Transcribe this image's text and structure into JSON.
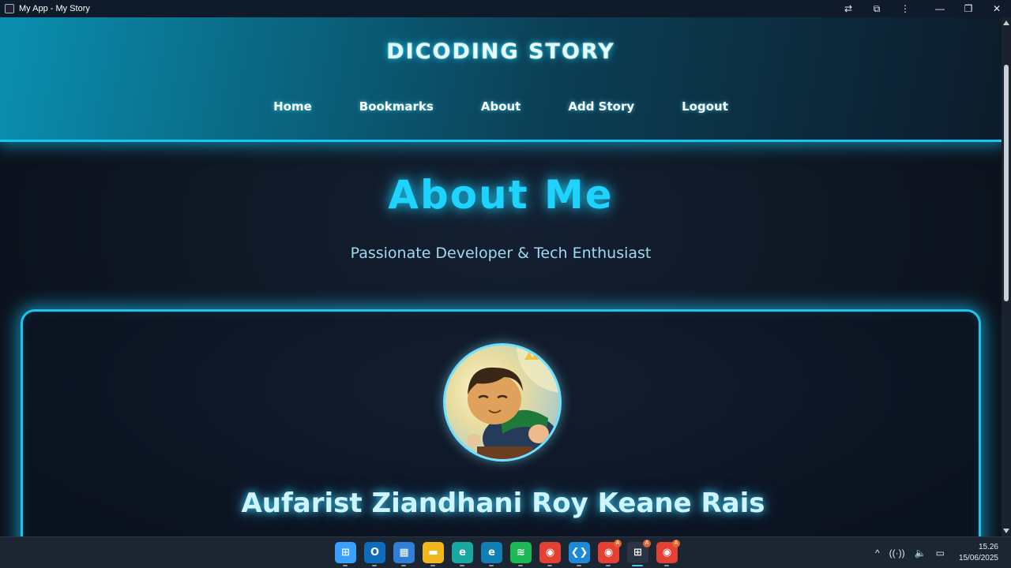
{
  "window": {
    "title": "My App - My Story",
    "buttons": {
      "translate": "⇄",
      "extensions": "⧉",
      "menu": "⋮",
      "minimize": "—",
      "restore": "❐",
      "close": "✕"
    }
  },
  "header": {
    "brand": "DICODING STORY",
    "nav": [
      "Home",
      "Bookmarks",
      "About",
      "Add Story",
      "Logout"
    ]
  },
  "hero": {
    "title": "About Me",
    "subtitle": "Passionate Developer & Tech Enthusiast"
  },
  "profile": {
    "name": "Aufarist Ziandhani Roy Keane Rais"
  },
  "taskbar": {
    "apps": [
      {
        "name": "windows-start",
        "color": "#3aa0ff",
        "glyph": "⊞"
      },
      {
        "name": "outlook",
        "color": "#0f6cbd",
        "glyph": "O"
      },
      {
        "name": "microsoft-store",
        "color": "#2f7fd6",
        "glyph": "▦"
      },
      {
        "name": "file-explorer",
        "color": "#f2b71c",
        "glyph": "▬"
      },
      {
        "name": "edge",
        "color": "#1aa7a0",
        "glyph": "e"
      },
      {
        "name": "edge-dev",
        "color": "#0f7fb5",
        "glyph": "e"
      },
      {
        "name": "spotify",
        "color": "#1db954",
        "glyph": "≋"
      },
      {
        "name": "chrome",
        "color": "#e44134",
        "glyph": "◉"
      },
      {
        "name": "vscode",
        "color": "#1c8ad6",
        "glyph": "❮❯"
      },
      {
        "name": "chrome-profile",
        "color": "#e44134",
        "glyph": "◉",
        "badge": "A"
      },
      {
        "name": "apps-grid",
        "color": "#2b3442",
        "glyph": "⊞",
        "badge": "A",
        "active": true
      },
      {
        "name": "chrome-profile-2",
        "color": "#e44134",
        "glyph": "◉",
        "badge": "A"
      }
    ],
    "tray": {
      "chevron": "^",
      "wifi": "((·))",
      "volume": "🔈",
      "battery": "▭"
    },
    "time": "15.26",
    "date": "15/06/2025"
  }
}
